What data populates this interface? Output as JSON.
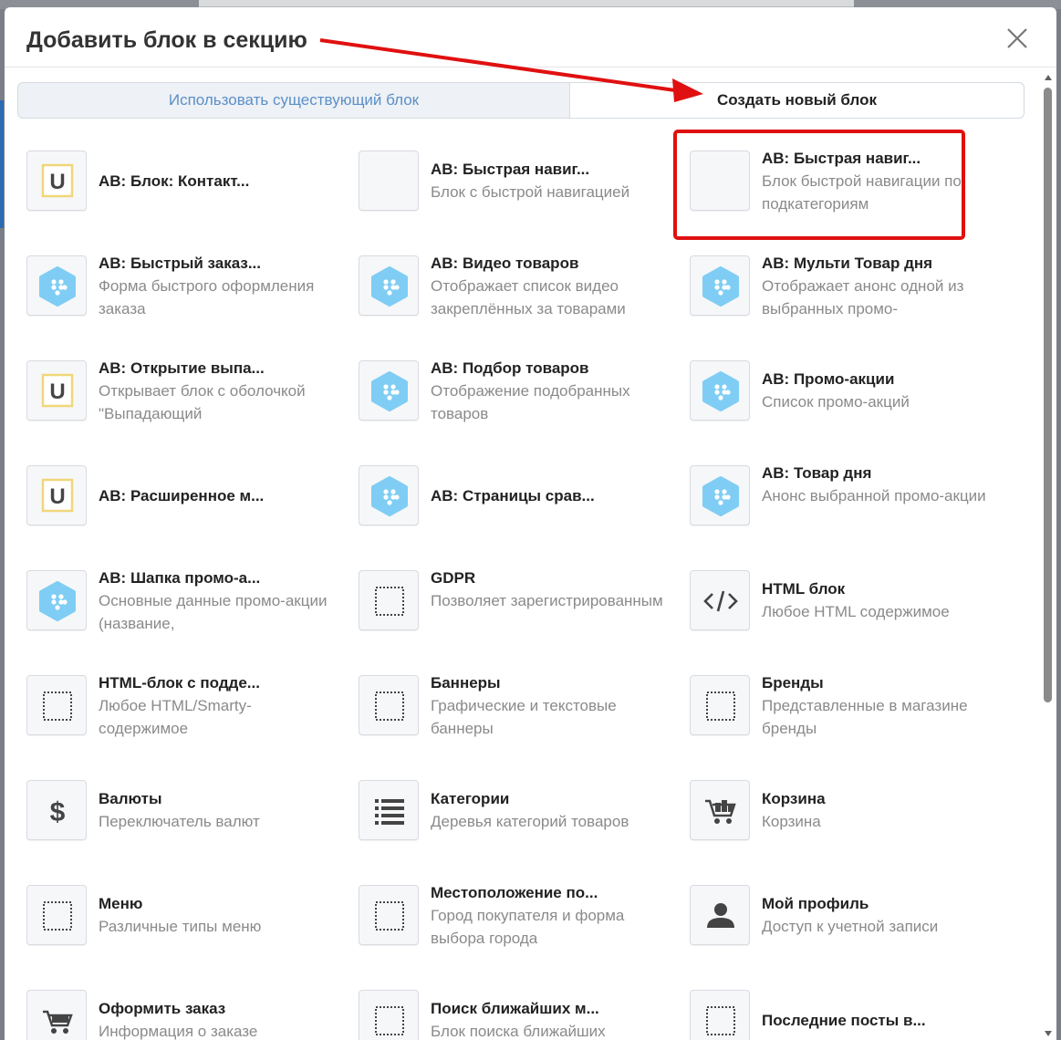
{
  "modal": {
    "title": "Добавить блок в секцию"
  },
  "tabs": {
    "existing_label": "Использовать существующий блок",
    "new_label": "Создать новый блок"
  },
  "colors": {
    "annotation": "#e01010",
    "hex_icon": "#7fcdf4",
    "u_icon_border": "#f0d77a",
    "tab_link": "#5b8fc7"
  },
  "blocks": [
    {
      "icon": "u-letter-icon",
      "title": "AB: Блок: Контакт...",
      "desc": ""
    },
    {
      "icon": "blank-icon",
      "title": "AB: Быстрая навиг...",
      "desc": "Блок с быстрой навигацией"
    },
    {
      "icon": "blank-icon",
      "title": "AB: Быстрая навиг...",
      "desc": "Блок быстрой навигации по подкатегориям"
    },
    {
      "icon": "hexagon-dots-icon",
      "title": "AB: Быстрый заказ...",
      "desc": "Форма быстрого оформления заказа"
    },
    {
      "icon": "hexagon-dots-icon",
      "title": "AB: Видео товаров",
      "desc": "Отображает список видео закреплённых за товарами"
    },
    {
      "icon": "hexagon-dots-icon",
      "title": "AB: Мульти Товар дня",
      "desc": "Отображает анонс одной из выбранных промо-"
    },
    {
      "icon": "u-letter-icon",
      "title": "AB: Открытие выпа...",
      "desc": "Открывает блок с оболочкой \"Выпадающий"
    },
    {
      "icon": "hexagon-dots-icon",
      "title": "AB: Подбор товаров",
      "desc": "Отображение подобранных товаров"
    },
    {
      "icon": "hexagon-dots-icon",
      "title": "AB: Промо-акции",
      "desc": "Список промо-акций"
    },
    {
      "icon": "u-letter-icon",
      "title": "AB: Расширенное м...",
      "desc": ""
    },
    {
      "icon": "hexagon-dots-icon",
      "title": "AB: Страницы срав...",
      "desc": ""
    },
    {
      "icon": "hexagon-dots-icon",
      "title": "AB: Товар дня",
      "desc": "Анонс выбранной промо-акции"
    },
    {
      "icon": "hexagon-dots-icon",
      "title": "AB: Шапка промо-а...",
      "desc": "Основные данные промо-акции (название,"
    },
    {
      "icon": "dotted-square-icon",
      "title": "GDPR",
      "desc": "Позволяет зарегистрированным"
    },
    {
      "icon": "code-icon",
      "title": "HTML блок",
      "desc": "Любое HTML содержимое"
    },
    {
      "icon": "dotted-square-icon",
      "title": "HTML-блок с подде...",
      "desc": "Любое HTML/Smarty-содержимое"
    },
    {
      "icon": "dotted-square-icon",
      "title": "Баннеры",
      "desc": "Графические и текстовые баннеры"
    },
    {
      "icon": "dotted-square-icon",
      "title": "Бренды",
      "desc": "Представленные в магазине бренды"
    },
    {
      "icon": "dollar-icon",
      "title": "Валюты",
      "desc": "Переключатель валют"
    },
    {
      "icon": "list-icon",
      "title": "Категории",
      "desc": "Деревья категорий товаров"
    },
    {
      "icon": "cart-full-icon",
      "title": "Корзина",
      "desc": "Корзина"
    },
    {
      "icon": "dotted-square-icon",
      "title": "Меню",
      "desc": "Различные типы меню"
    },
    {
      "icon": "dotted-square-icon",
      "title": "Местоположение по...",
      "desc": "Город покупателя и форма выбора города"
    },
    {
      "icon": "user-icon",
      "title": "Мой профиль",
      "desc": "Доступ к учетной записи"
    },
    {
      "icon": "cart-icon",
      "title": "Оформить заказ",
      "desc": "Информация о заказе"
    },
    {
      "icon": "dotted-square-icon",
      "title": "Поиск ближайших м...",
      "desc": "Блок поиска ближайших"
    },
    {
      "icon": "dotted-square-icon",
      "title": "Последние посты в...",
      "desc": ""
    }
  ]
}
